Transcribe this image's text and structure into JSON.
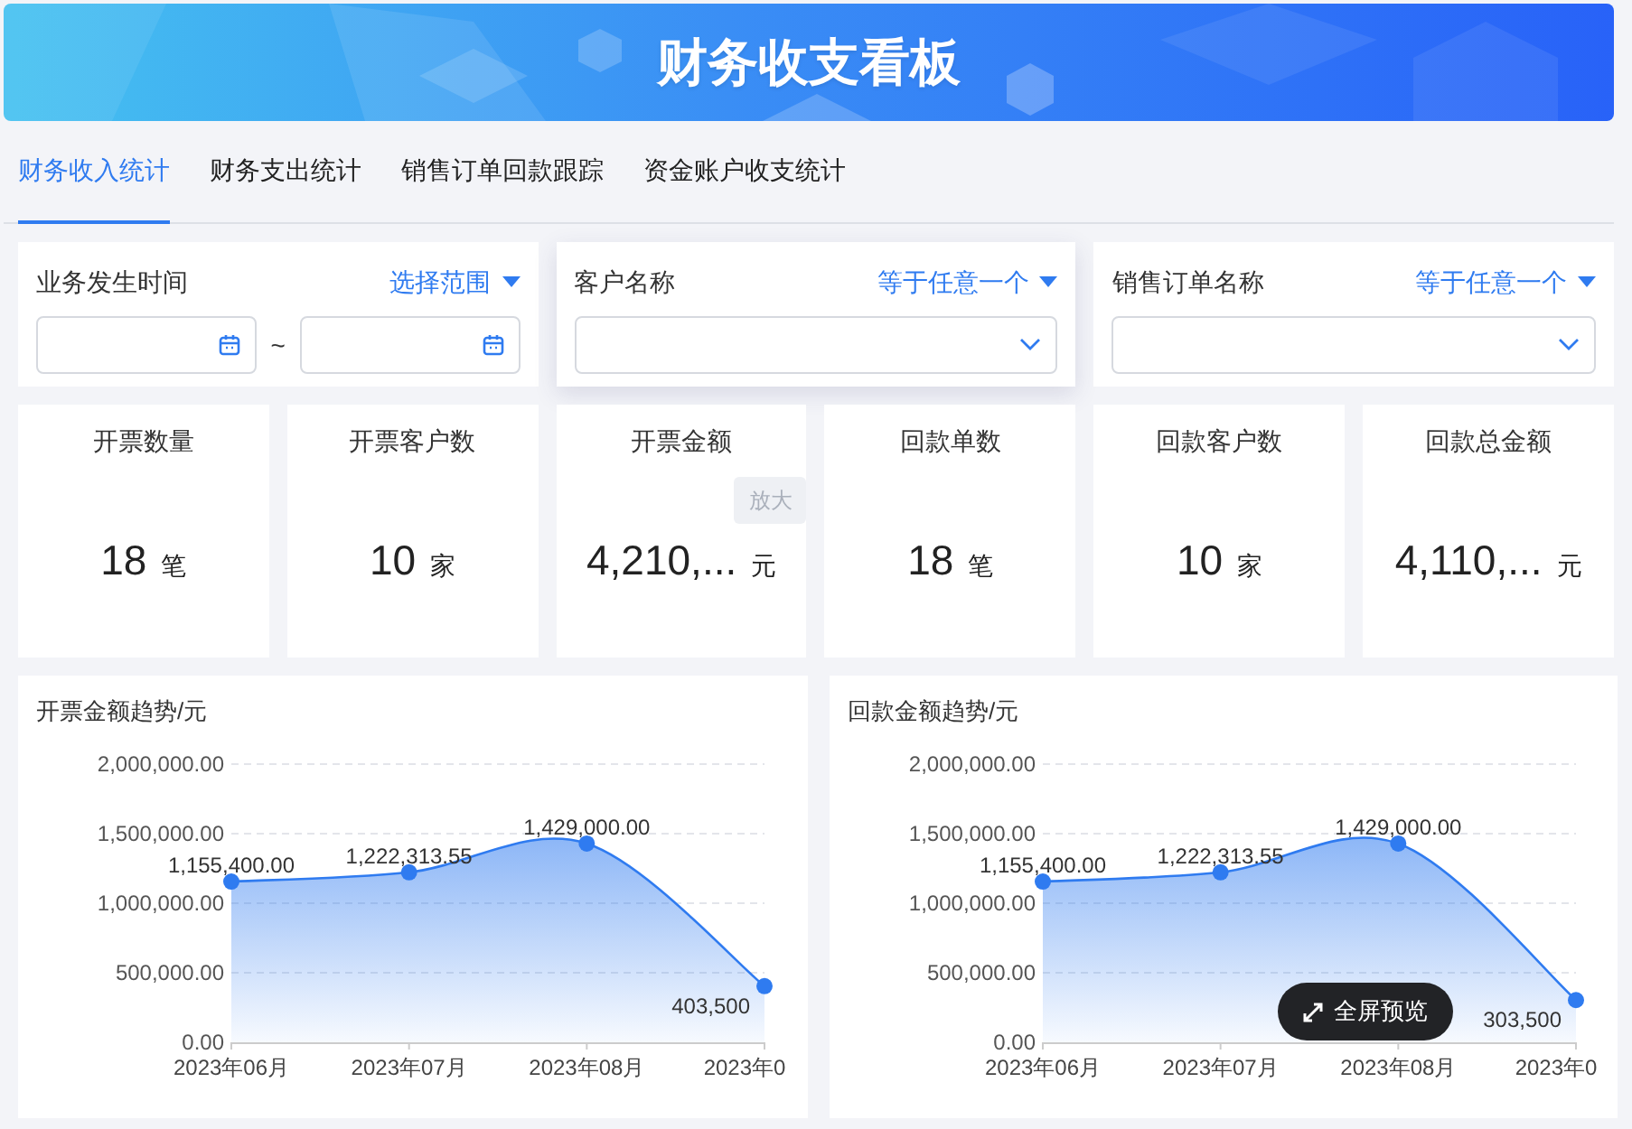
{
  "header": {
    "title": "财务收支看板"
  },
  "tabs": [
    {
      "label": "财务收入统计",
      "selected": true
    },
    {
      "label": "财务支出统计",
      "selected": false
    },
    {
      "label": "销售订单回款跟踪",
      "selected": false
    },
    {
      "label": "资金账户收支统计",
      "selected": false
    }
  ],
  "filters": [
    {
      "kind": "daterange",
      "label": "业务发生时间",
      "operator": "选择范围",
      "separator": "~",
      "raised": false
    },
    {
      "kind": "select",
      "label": "客户名称",
      "operator": "等于任意一个",
      "raised": true
    },
    {
      "kind": "select",
      "label": "销售订单名称",
      "operator": "等于任意一个",
      "raised": false
    }
  ],
  "kpis": [
    {
      "title": "开票数量",
      "value": "18",
      "unit": "笔"
    },
    {
      "title": "开票客户数",
      "value": "10",
      "unit": "家"
    },
    {
      "title": "开票金额",
      "value": "4,210,...",
      "unit": "元",
      "tooltip": "放大"
    },
    {
      "title": "回款单数",
      "value": "18",
      "unit": "笔"
    },
    {
      "title": "回款客户数",
      "value": "10",
      "unit": "家"
    },
    {
      "title": "回款总金额",
      "value": "4,110,...",
      "unit": "元"
    }
  ],
  "charts": [
    {
      "title": "开票金额趋势/元",
      "chart_data": {
        "type": "area",
        "categories": [
          "2023年06月",
          "2023年07月",
          "2023年08月",
          "2023年0"
        ],
        "series": [
          {
            "color": "#2f7bf0",
            "values": [
              1155400,
              1222313.55,
              1429000,
              403500
            ]
          }
        ],
        "grid": true,
        "ylim": [
          0,
          2000000
        ],
        "yticks": [
          {
            "value": 0,
            "label": "0.00"
          },
          {
            "value": 500000,
            "label": "500,000.00"
          },
          {
            "value": 1000000,
            "label": "1,000,000.00"
          },
          {
            "value": 1500000,
            "label": "1,500,000.00"
          },
          {
            "value": 2000000,
            "label": "2,000,000.00"
          }
        ],
        "value_labels": [
          "1,155,400.00",
          "1,222,313.55",
          "1,429,000.00",
          "403,500"
        ]
      }
    },
    {
      "title": "回款金额趋势/元",
      "chart_data": {
        "type": "area",
        "categories": [
          "2023年06月",
          "2023年07月",
          "2023年08月",
          "2023年0"
        ],
        "series": [
          {
            "color": "#2f7bf0",
            "values": [
              1155400,
              1222313.55,
              1429000,
              303500
            ]
          }
        ],
        "grid": true,
        "ylim": [
          0,
          2000000
        ],
        "yticks": [
          {
            "value": 0,
            "label": "0.00"
          },
          {
            "value": 500000,
            "label": "500,000.00"
          },
          {
            "value": 1000000,
            "label": "1,000,000.00"
          },
          {
            "value": 1500000,
            "label": "1,500,000.00"
          },
          {
            "value": 2000000,
            "label": "2,000,000.00"
          }
        ],
        "value_labels": [
          "1,155,400.00",
          "1,222,313.55",
          "1,429,000.00",
          "303,500"
        ]
      },
      "overlay_button": "全屏预览"
    }
  ]
}
